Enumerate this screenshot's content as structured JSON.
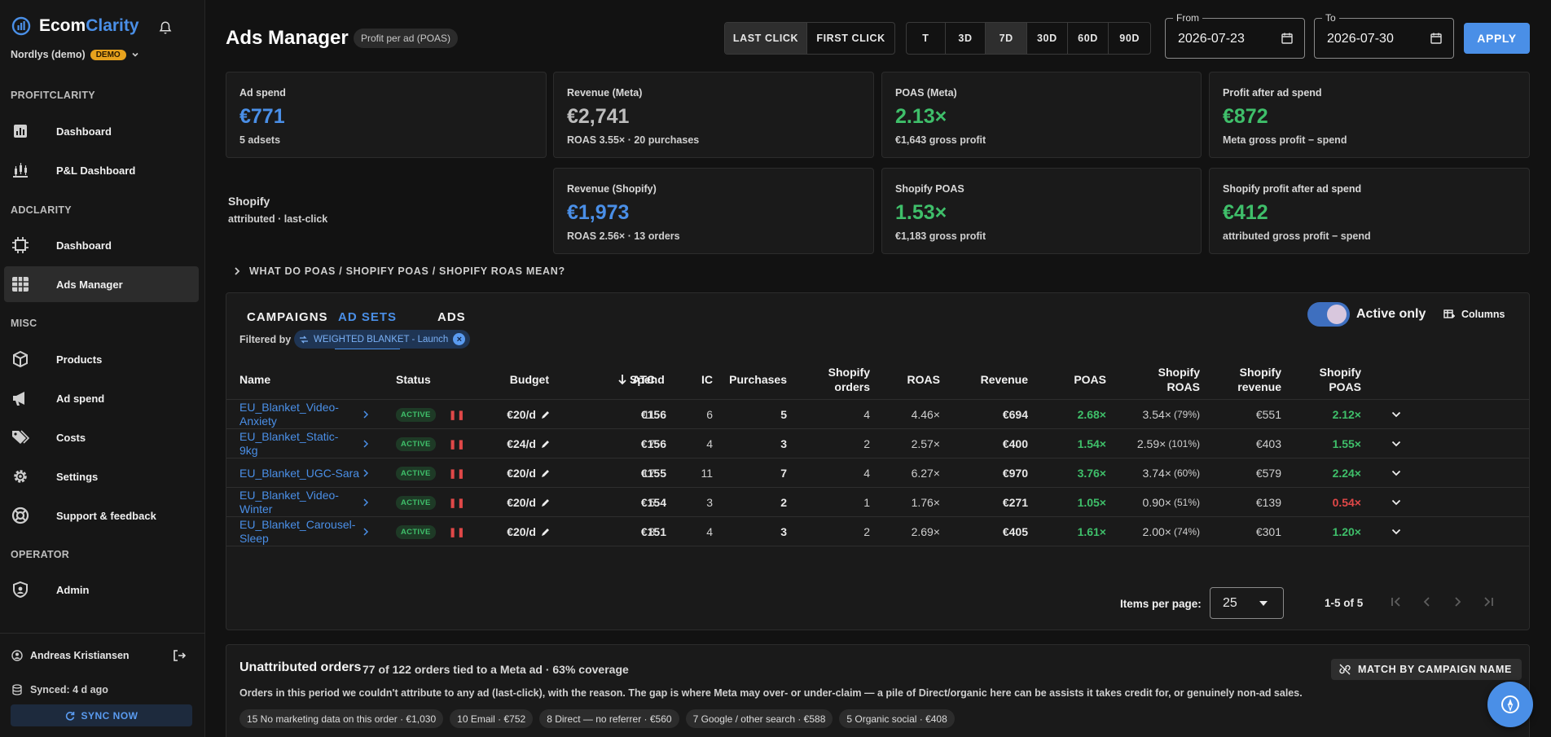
{
  "app": {
    "brand_a": "Ecom",
    "brand_b": "Clarity",
    "org": "Nordlys (demo)",
    "org_badge": "DEMO"
  },
  "sidebar": {
    "sections": [
      "PROFITCLARITY",
      "ADCLARITY",
      "MISC",
      "OPERATOR"
    ],
    "items": [
      {
        "label": "Dashboard",
        "icon": "bar-chart-icon"
      },
      {
        "label": "P&L Dashboard",
        "icon": "candlestick-icon"
      },
      {
        "label": "Dashboard",
        "icon": "chip-icon"
      },
      {
        "label": "Ads Manager",
        "icon": "grid-table-icon"
      },
      {
        "label": "Products",
        "icon": "box-icon"
      },
      {
        "label": "Ad spend",
        "icon": "megaphone-icon"
      },
      {
        "label": "Costs",
        "icon": "tags-icon"
      },
      {
        "label": "Settings",
        "icon": "gear-icon"
      },
      {
        "label": "Support & feedback",
        "icon": "lifebuoy-icon"
      },
      {
        "label": "Admin",
        "icon": "shield-icon"
      }
    ],
    "user": "Andreas Kristiansen",
    "synced": "Synced: 4 d ago",
    "sync_button": "SYNC NOW"
  },
  "header": {
    "title": "Ads Manager",
    "badge": "Profit per ad (POAS)",
    "attribution": [
      "LAST CLICK",
      "FIRST CLICK"
    ],
    "attribution_selected": "LAST CLICK",
    "ranges": [
      "T",
      "3D",
      "7D",
      "30D",
      "60D",
      "90D"
    ],
    "range_selected": "7D",
    "from_label": "From",
    "from_value": "2026-07-23",
    "to_label": "To",
    "to_value": "2026-07-30",
    "apply": "APPLY"
  },
  "cards": [
    {
      "label": "Ad spend",
      "value": "€771",
      "sub": "5 adsets"
    },
    {
      "label": "Revenue (Meta)",
      "value": "€2,741",
      "sub": "ROAS 3.55× · 20 purchases"
    },
    {
      "label": "POAS (Meta)",
      "value": "2.13×",
      "sub": "€1,643 gross profit"
    },
    {
      "label": "Profit after ad spend",
      "value": "€872",
      "sub": "Meta gross profit − spend"
    },
    {
      "label": "Revenue (Shopify)",
      "value": "€1,973",
      "sub": "ROAS 2.56× · 13 orders"
    },
    {
      "label": "Shopify POAS",
      "value": "1.53×",
      "sub": "€1,183 gross profit"
    },
    {
      "label": "Shopify profit after ad spend",
      "value": "€412",
      "sub": "attributed gross profit − spend"
    }
  ],
  "shopify_label": "Shopify",
  "shopify_sub": "attributed · last-click",
  "explainer": "WHAT DO POAS / SHOPIFY POAS / SHOPIFY ROAS MEAN?",
  "table": {
    "tabs": [
      "CAMPAIGNS",
      "AD SETS",
      "ADS"
    ],
    "tab_selected": "AD SETS",
    "active_only": "Active only",
    "columns_btn": "Columns",
    "filtered_by": "Filtered by",
    "filter_chip": "WEIGHTED BLANKET - Launch",
    "headers": {
      "name": "Name",
      "status": "Status",
      "budget": "Budget",
      "spend": "Spend",
      "atc": "ATC",
      "ic": "IC",
      "purchases": "Purchases",
      "shopify_orders_1": "Shopify",
      "shopify_orders_2": "orders",
      "roas": "ROAS",
      "revenue": "Revenue",
      "poas": "POAS",
      "sroas_1": "Shopify",
      "sroas_2": "ROAS",
      "srev_1": "Shopify",
      "srev_2": "revenue",
      "spoas_1": "Shopify",
      "spoas_2": "POAS"
    },
    "rows": [
      {
        "name_1": "EU_Blanket_Video-",
        "name_2": "Anxiety",
        "status": "ACTIVE",
        "budget": "€20/d",
        "spend": "€156",
        "atc": "11",
        "ic": "6",
        "purchases": "5",
        "orders": "4",
        "roas": "4.46×",
        "revenue": "€694",
        "poas": "2.68×",
        "sroas": "3.54×",
        "sroas_pct": "(79%)",
        "srev": "€551",
        "spoas": "2.12×",
        "spoas_color": "green"
      },
      {
        "name_1": "EU_Blanket_Static-",
        "name_2": "9kg",
        "status": "ACTIVE",
        "budget": "€24/d",
        "spend": "€156",
        "atc": "7",
        "ic": "4",
        "purchases": "3",
        "orders": "2",
        "roas": "2.57×",
        "revenue": "€400",
        "poas": "1.54×",
        "sroas": "2.59×",
        "sroas_pct": "(101%)",
        "srev": "€403",
        "spoas": "1.55×",
        "spoas_color": "green"
      },
      {
        "name_1": "EU_Blanket_UGC-Sara",
        "name_2": "",
        "status": "ACTIVE",
        "budget": "€20/d",
        "spend": "€155",
        "atc": "17",
        "ic": "11",
        "purchases": "7",
        "orders": "4",
        "roas": "6.27×",
        "revenue": "€970",
        "poas": "3.76×",
        "sroas": "3.74×",
        "sroas_pct": "(60%)",
        "srev": "€579",
        "spoas": "2.24×",
        "spoas_color": "green"
      },
      {
        "name_1": "EU_Blanket_Video-",
        "name_2": "Winter",
        "status": "ACTIVE",
        "budget": "€20/d",
        "spend": "€154",
        "atc": "5",
        "ic": "3",
        "purchases": "2",
        "orders": "1",
        "roas": "1.76×",
        "revenue": "€271",
        "poas": "1.05×",
        "sroas": "0.90×",
        "sroas_pct": "(51%)",
        "srev": "€139",
        "spoas": "0.54×",
        "spoas_color": "red"
      },
      {
        "name_1": "EU_Blanket_Carousel-",
        "name_2": "Sleep",
        "status": "ACTIVE",
        "budget": "€20/d",
        "spend": "€151",
        "atc": "8",
        "ic": "4",
        "purchases": "3",
        "orders": "2",
        "roas": "2.69×",
        "revenue": "€405",
        "poas": "1.61×",
        "sroas": "2.00×",
        "sroas_pct": "(74%)",
        "srev": "€301",
        "spoas": "1.20×",
        "spoas_color": "green"
      }
    ],
    "items_per_page_label": "Items per page:",
    "items_per_page": "25",
    "range": "1-5 of 5"
  },
  "unattributed": {
    "title": "Unattributed orders",
    "summary": "77 of 122 orders tied to a Meta ad · 63% coverage",
    "match_button": "MATCH BY CAMPAIGN NAME",
    "description": "Orders in this period we couldn't attribute to any ad (last-click), with the reason. The gap is where Meta may over- or under-claim — a pile of Direct/organic here can be assists it takes credit for, or genuinely non-ad sales.",
    "pills": [
      "15 No marketing data on this order · €1,030",
      "10 Email · €752",
      "8 Direct — no referrer · €560",
      "7 Google / other search · €588",
      "5 Organic social · €408"
    ]
  },
  "colors": {
    "accent": "#4a8fe7",
    "positive": "#3fbf6a",
    "negative": "#e04848",
    "demo": "#e7a21d"
  }
}
